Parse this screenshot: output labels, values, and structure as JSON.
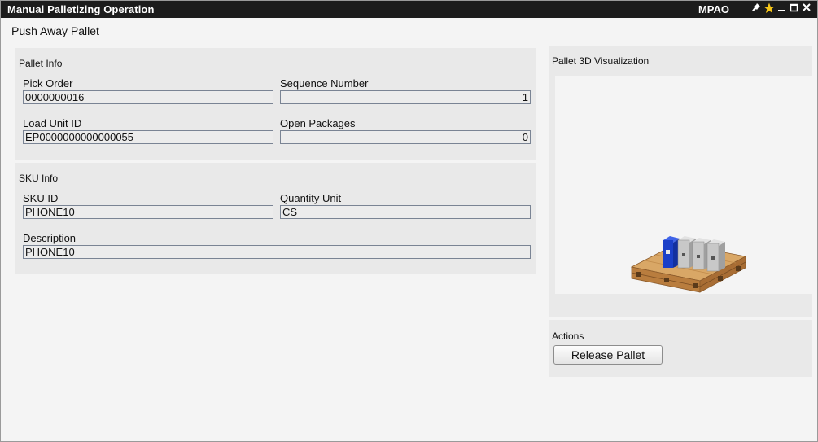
{
  "window": {
    "title": "Manual Palletizing Operation",
    "app_code": "MPAO",
    "icons": [
      "pin-icon",
      "star-icon",
      "minimize-icon",
      "maximize-icon",
      "close-icon"
    ]
  },
  "page": {
    "subtitle": "Push Away Pallet"
  },
  "pallet_info": {
    "title": "Pallet Info",
    "pick_order": {
      "label": "Pick Order",
      "value": "0000000016"
    },
    "sequence_number": {
      "label": "Sequence Number",
      "value": "1"
    },
    "load_unit_id": {
      "label": "Load Unit ID",
      "value": "EP0000000000000055"
    },
    "open_packages": {
      "label": "Open Packages",
      "value": "0"
    }
  },
  "sku_info": {
    "title": "SKU Info",
    "sku_id": {
      "label": "SKU ID",
      "value": "PHONE10"
    },
    "quantity_unit": {
      "label": "Quantity Unit",
      "value": "CS"
    },
    "description": {
      "label": "Description",
      "value": "PHONE10"
    }
  },
  "visualization": {
    "title": "Pallet 3D Visualization",
    "box_count": 4,
    "highlight_color": "#1a3fc8",
    "box_color": "#c8c8c8",
    "pallet_color": "#c8924f"
  },
  "actions": {
    "title": "Actions",
    "release_button": "Release Pallet"
  }
}
